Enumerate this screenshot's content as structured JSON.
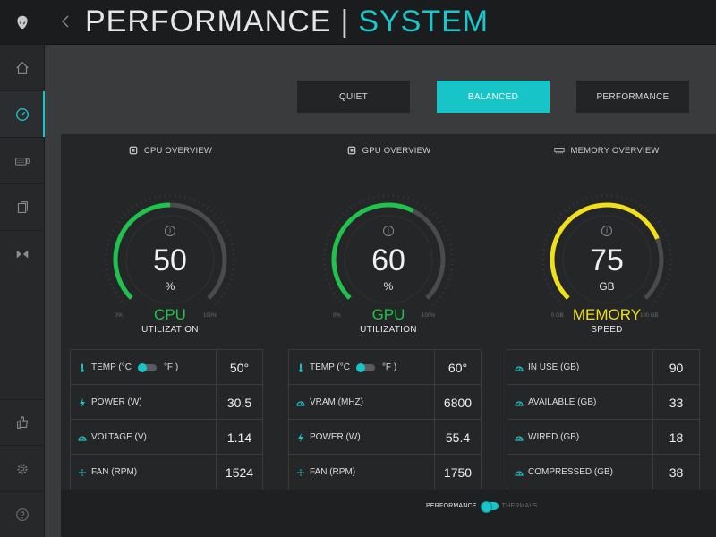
{
  "header": {
    "title_primary": "PERFORMANCE",
    "separator": "|",
    "title_secondary": "SYSTEM"
  },
  "sidebar": {
    "items": [
      {
        "name": "alien-logo",
        "icon": "alien-head-icon"
      },
      {
        "name": "home",
        "icon": "home-icon"
      },
      {
        "name": "performance",
        "icon": "speedometer-icon",
        "active": true
      },
      {
        "name": "keyboard",
        "icon": "keyboard-icon"
      },
      {
        "name": "library",
        "icon": "library-icon"
      },
      {
        "name": "fx",
        "icon": "fx-icon"
      },
      {
        "name": "like",
        "icon": "thumbs-up-icon"
      },
      {
        "name": "settings",
        "icon": "gear-icon"
      },
      {
        "name": "help",
        "icon": "question-icon"
      }
    ]
  },
  "modes": [
    {
      "label": "QUIET",
      "active": false
    },
    {
      "label": "BALANCED",
      "active": true
    },
    {
      "label": "PERFORMANCE",
      "active": false
    }
  ],
  "cpu": {
    "header": "CPU OVERVIEW",
    "value": "50",
    "unit": "%",
    "fraction": 0.5,
    "min": "0%",
    "max": "100%",
    "label": "CPU",
    "sub": "UTILIZATION",
    "color": "#1fc24c",
    "rows": [
      {
        "label": "TEMP (°C",
        "label_suffix": "°F )",
        "value": "50°",
        "icon": "thermometer-icon",
        "toggle": true
      },
      {
        "label": "POWER (W)",
        "value": "30.5",
        "icon": "lightning-icon"
      },
      {
        "label": "VOLTAGE (V)",
        "value": "1.14",
        "icon": "gauge-icon"
      },
      {
        "label": "FAN (RPM)",
        "value": "1524",
        "icon": "fan-icon"
      }
    ]
  },
  "gpu": {
    "header": "GPU OVERVIEW",
    "value": "60",
    "unit": "%",
    "fraction": 0.6,
    "min": "0%",
    "max": "100%",
    "label": "GPU",
    "sub": "UTILIZATION",
    "color": "#1fc24c",
    "rows": [
      {
        "label": "TEMP (°C",
        "label_suffix": "°F )",
        "value": "60°",
        "icon": "thermometer-icon",
        "toggle": true
      },
      {
        "label": "VRAM (MHZ)",
        "value": "6800",
        "icon": "gauge-icon"
      },
      {
        "label": "POWER (W)",
        "value": "55.4",
        "icon": "lightning-icon"
      },
      {
        "label": "FAN (RPM)",
        "value": "1750",
        "icon": "fan-icon"
      }
    ]
  },
  "memory": {
    "header": "MEMORY OVERVIEW",
    "value": "75",
    "unit": "GB",
    "fraction": 0.75,
    "min": "0 GB",
    "max": "100 GB",
    "label": "MEMORY",
    "sub": "SPEED",
    "color": "#f0e01a",
    "rows": [
      {
        "label": "IN USE (GB)",
        "value": "90",
        "icon": "gauge-icon"
      },
      {
        "label": "AVAILABLE (GB)",
        "value": "33",
        "icon": "gauge-icon"
      },
      {
        "label": "WIRED (GB)",
        "value": "18",
        "icon": "gauge-icon"
      },
      {
        "label": "COMPRESSED (GB)",
        "value": "38",
        "icon": "gauge-icon"
      }
    ]
  },
  "footer": {
    "left_label": "PERFORMANCE",
    "right_label": "THERMALS"
  },
  "colors": {
    "accent": "#17c5c9",
    "track": "#4a4b4e"
  }
}
